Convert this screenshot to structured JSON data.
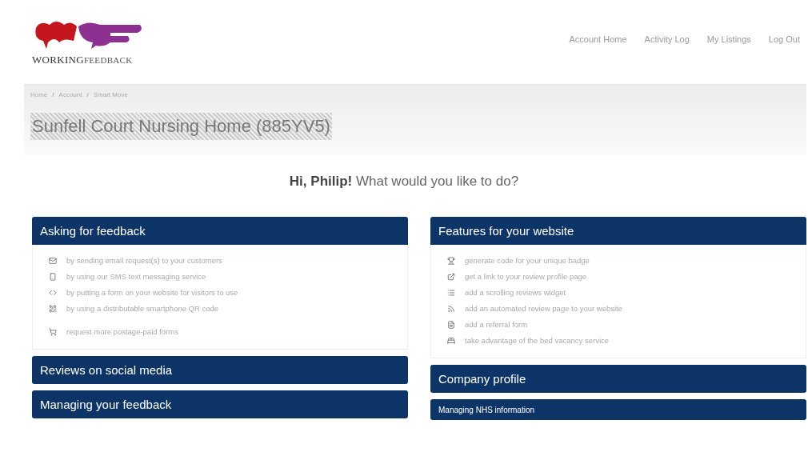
{
  "logo": {
    "word_bold": "WORKING",
    "word_light": "FEEDBACK"
  },
  "nav": [
    "Account Home",
    "Activity Log",
    "My Listings",
    "Log Out"
  ],
  "breadcrumb": [
    "Home",
    "Account",
    "Smart Move"
  ],
  "breadcrumb_separator": "/",
  "page_title": "Sunfell Court Nursing Home (885YV5)",
  "greeting": "**Hi, Philip!** What would you like to do?",
  "columns": [
    {
      "panels": [
        {
          "title": "Asking for feedback",
          "kind": "header",
          "groups": [
            [
              "by sending email request(s) to your customers",
              "by using our SMS text messaging service",
              "by putting a form on your website for visitors to use",
              "by using a distributable smartphone QR code"
            ],
            [
              "request more postage-paid forms"
            ]
          ]
        },
        {
          "title": "Reviews on social media",
          "kind": "header"
        },
        {
          "title": "Managing your feedback",
          "kind": "header"
        }
      ]
    },
    {
      "panels": [
        {
          "title": "Features for your website",
          "kind": "header",
          "groups": [
            [
              "generate code for your unique badge",
              "get a link to your review profile page",
              "add a scrolling reviews widget",
              "add an automated review page to your website",
              "add a referral form",
              "take advantage of the bed vacancy service"
            ]
          ]
        },
        {
          "title": "Company profile",
          "kind": "header"
        },
        {
          "title": "Managing NHS information",
          "kind": "subheader"
        }
      ]
    }
  ]
}
